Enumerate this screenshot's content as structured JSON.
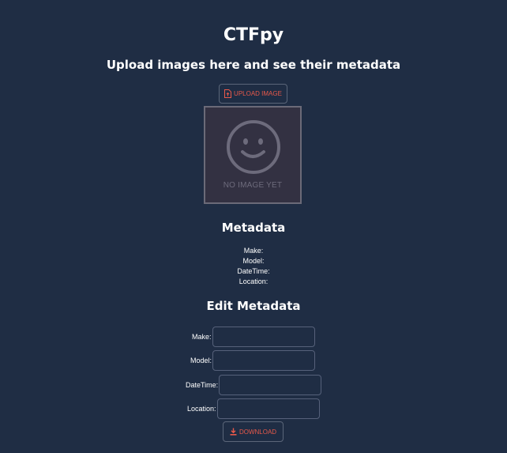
{
  "header": {
    "title": "CTFpy",
    "subtitle": "Upload images here and see their metadata"
  },
  "upload": {
    "button_label": "UPLOAD IMAGE",
    "icon": "file-upload-icon"
  },
  "preview": {
    "placeholder_text": "NO IMAGE YET",
    "icon": "smiley-face-icon"
  },
  "metadata": {
    "title": "Metadata",
    "items": [
      {
        "label": "Make:",
        "value": ""
      },
      {
        "label": "Model:",
        "value": ""
      },
      {
        "label": "DateTime:",
        "value": ""
      },
      {
        "label": "Location:",
        "value": ""
      }
    ]
  },
  "edit": {
    "title": "Edit Metadata",
    "fields": [
      {
        "label": "Make:",
        "value": "",
        "placeholder": ""
      },
      {
        "label": "Model:",
        "value": "",
        "placeholder": ""
      },
      {
        "label": "DateTime:",
        "value": "",
        "placeholder": ""
      },
      {
        "label": "Location:",
        "value": "",
        "placeholder": ""
      }
    ]
  },
  "download": {
    "button_label": "DOWNLOAD",
    "icon": "download-icon"
  },
  "colors": {
    "background": "#1f2d44",
    "accent": "#e8594a",
    "preview_bg": "#333142",
    "preview_border": "#6b6a78"
  }
}
